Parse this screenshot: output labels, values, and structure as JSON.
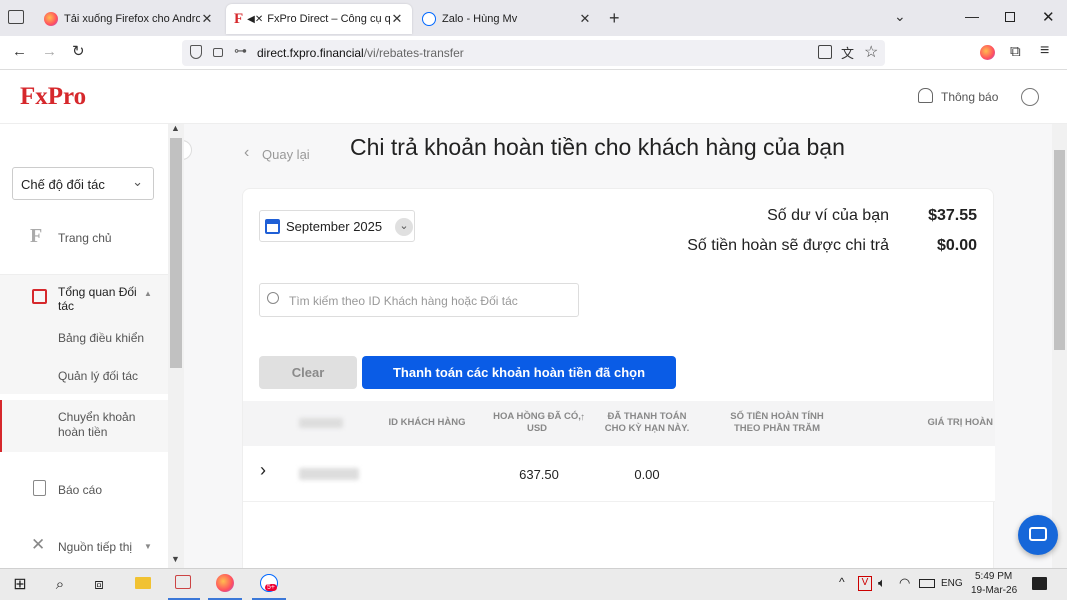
{
  "browser": {
    "tabs": [
      {
        "title": "Tải xuống Firefox cho Android v",
        "favicon": "firefox-icon",
        "active": false
      },
      {
        "title": "FxPro Direct – Công cụ quả",
        "favicon": "fxpro-icon",
        "active": true,
        "muted": true
      },
      {
        "title": "Zalo - Hùng Mv",
        "favicon": "zalo-icon",
        "active": false
      }
    ],
    "url_host": "direct.fxpro.financial",
    "url_path": "/vi/rebates-transfer"
  },
  "header": {
    "logo": "FxPro",
    "notifications_label": "Thông báo"
  },
  "sidebar": {
    "mode_select": "Chế độ đối tác",
    "items": [
      {
        "label": "Trang chủ",
        "icon": "fxpro-f-icon"
      },
      {
        "label": "Tổng quan Đối tác",
        "icon": "dashboard-grid-icon"
      },
      {
        "label": "Bảng điều khiển"
      },
      {
        "label": "Quản lý đối tác"
      },
      {
        "label": "Chuyển khoản hoàn tiền",
        "active": true
      },
      {
        "label": "Báo cáo",
        "icon": "report-icon"
      },
      {
        "label": "Nguồn tiếp thị",
        "icon": "tools-icon"
      }
    ]
  },
  "main": {
    "back_label": "Quay lại",
    "title": "Chi trả khoản hoàn tiền cho khách hàng của bạn",
    "month": "September 2025",
    "wallet_label": "Số dư ví của bạn",
    "wallet_value": "$37.55",
    "payout_label": "Số tiền hoàn sẽ được chi trả",
    "payout_value": "$0.00",
    "search_placeholder": "Tìm kiếm theo ID Khách hàng hoặc Đối tác",
    "clear_label": "Clear",
    "pay_label": "Thanh toán các khoản hoàn tiền đã chọn",
    "table": {
      "headers": [
        "ID KHÁCH HÀNG",
        "HOA HỒNG ĐÃ CÓ, USD",
        "ĐÃ THANH TOÁN CHO KỲ HẠN NÀY.",
        "SỐ TIỀN HOÀN TÍNH THEO PHẦN TRĂM",
        "GIÁ TRỊ HOÀN"
      ],
      "rows": [
        {
          "commission": "637.50",
          "paid": "0.00"
        }
      ]
    }
  },
  "taskbar": {
    "time": "5:49 PM",
    "date": "19-Mar-26",
    "lang": "ENG",
    "zalo_badge": "5+"
  },
  "colors": {
    "brand_red": "#d6282c",
    "accent_blue": "#0a5ce6"
  }
}
